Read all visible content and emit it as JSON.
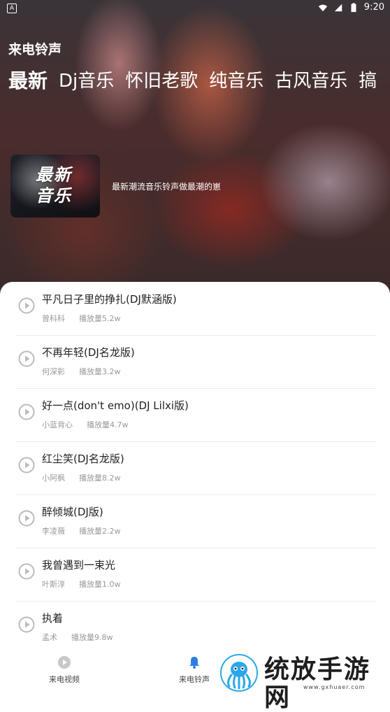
{
  "status_bar": {
    "time": "9:20",
    "notification": "A"
  },
  "app": {
    "title": "来电铃声"
  },
  "tabs": [
    {
      "label": "最新",
      "active": true
    },
    {
      "label": "Dj音乐",
      "active": false
    },
    {
      "label": "怀旧老歌",
      "active": false
    },
    {
      "label": "纯音乐",
      "active": false
    },
    {
      "label": "古风音乐",
      "active": false
    },
    {
      "label": "搞",
      "active": false
    }
  ],
  "featured": {
    "thumb_line1": "最新",
    "thumb_line2": "音乐",
    "description": "最新潮流音乐铃声做最潮的崽"
  },
  "songs": [
    {
      "title": "平凡日子里的挣扎(DJ默涵版)",
      "artist": "曾科科",
      "plays": "播放量5.2w"
    },
    {
      "title": "不再年轻(DJ名龙版)",
      "artist": "何深彰",
      "plays": "播放量3.2w"
    },
    {
      "title": "好一点(don't emo)(DJ Lilxi版)",
      "artist": "小蓝背心",
      "plays": "播放量4.7w"
    },
    {
      "title": "红尘笑(DJ名龙版)",
      "artist": "小阿枫",
      "plays": "播放量8.2w"
    },
    {
      "title": "醉倾城(DJ版)",
      "artist": "李凌薇",
      "plays": "播放量2.2w"
    },
    {
      "title": "我曾遇到一束光",
      "artist": "叶斯淳",
      "plays": "播放量1.0w"
    },
    {
      "title": "执着",
      "artist": "孟术",
      "plays": "播放量9.8w"
    }
  ],
  "bottom_nav": [
    {
      "label": "来电视频",
      "icon": "play-circle-icon",
      "active": false
    },
    {
      "label": "来电铃声",
      "icon": "bell-icon",
      "active": true
    }
  ],
  "watermark": {
    "text": "统放手游网",
    "url": "www.gxhuaer.com"
  },
  "colors": {
    "accent": "#2f7de1",
    "icon_gray": "#bbbbbb"
  }
}
